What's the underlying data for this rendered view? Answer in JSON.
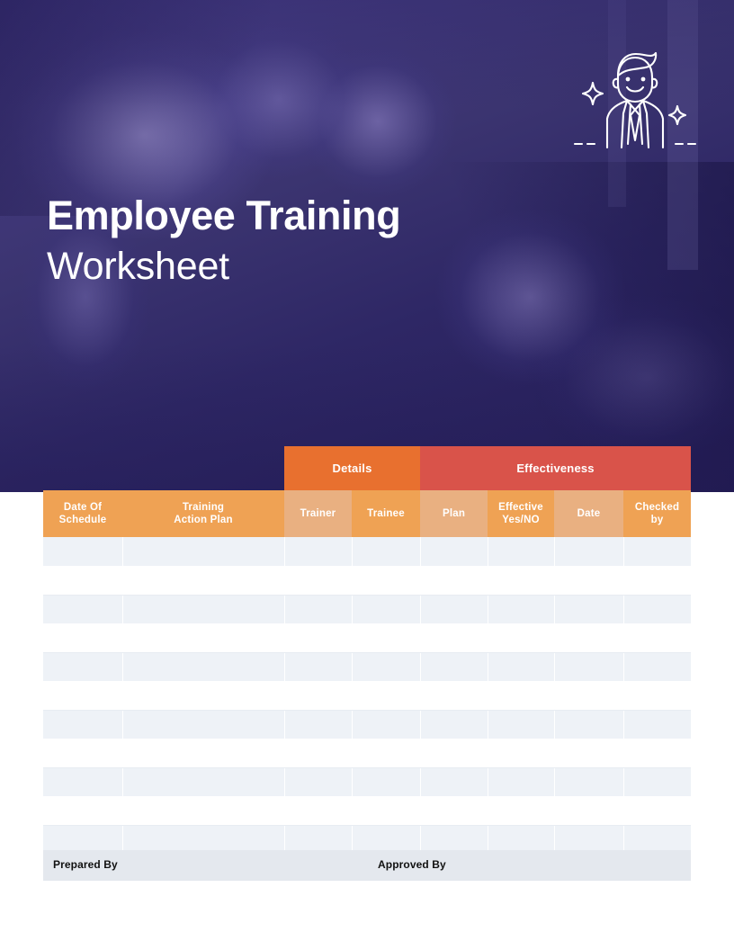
{
  "document": {
    "title_line1": "Employee Training",
    "title_line2": "Worksheet",
    "hero_icon": "businessman-line-art-icon",
    "colors": {
      "hero_purple": "#3B3470",
      "details_orange": "#E8702F",
      "effectiveness_red": "#D9534A",
      "header_cell_dark": "#EFA254",
      "header_cell_light": "#E9B081",
      "row_stripe": "#EEF2F7",
      "row_plain": "#FFFFFF",
      "footer_band": "#E4E8EE"
    }
  },
  "table": {
    "group_headers": [
      {
        "label": "",
        "span": 2,
        "style": "blank"
      },
      {
        "label": "Details",
        "span": 2,
        "style": "details"
      },
      {
        "label": "Effectiveness",
        "span": 4,
        "style": "effect"
      }
    ],
    "columns": [
      {
        "label": "Date Of\nSchedule",
        "line1": "Date Of",
        "line2": "Schedule",
        "shade": "dark"
      },
      {
        "label": "Training\nAction Plan",
        "line1": "Training",
        "line2": "Action Plan",
        "shade": "dark"
      },
      {
        "label": "Trainer",
        "line1": "Trainer",
        "line2": "",
        "shade": "light"
      },
      {
        "label": "Trainee",
        "line1": "Trainee",
        "line2": "",
        "shade": "dark"
      },
      {
        "label": "Plan",
        "line1": "Plan",
        "line2": "",
        "shade": "light"
      },
      {
        "label": "Effective\nYes/NO",
        "line1": "Effective",
        "line2": "Yes/NO",
        "shade": "dark"
      },
      {
        "label": "Date",
        "line1": "Date",
        "line2": "",
        "shade": "light"
      },
      {
        "label": "Checked\nby",
        "line1": "Checked",
        "line2": "by",
        "shade": "dark"
      }
    ],
    "row_count": 11,
    "rows": [
      [
        "",
        "",
        "",
        "",
        "",
        "",
        "",
        ""
      ],
      [
        "",
        "",
        "",
        "",
        "",
        "",
        "",
        ""
      ],
      [
        "",
        "",
        "",
        "",
        "",
        "",
        "",
        ""
      ],
      [
        "",
        "",
        "",
        "",
        "",
        "",
        "",
        ""
      ],
      [
        "",
        "",
        "",
        "",
        "",
        "",
        "",
        ""
      ],
      [
        "",
        "",
        "",
        "",
        "",
        "",
        "",
        ""
      ],
      [
        "",
        "",
        "",
        "",
        "",
        "",
        "",
        ""
      ],
      [
        "",
        "",
        "",
        "",
        "",
        "",
        "",
        ""
      ],
      [
        "",
        "",
        "",
        "",
        "",
        "",
        "",
        ""
      ],
      [
        "",
        "",
        "",
        "",
        "",
        "",
        "",
        ""
      ],
      [
        "",
        "",
        "",
        "",
        "",
        "",
        "",
        ""
      ]
    ]
  },
  "footer": {
    "prepared_by": "Prepared By",
    "approved_by": "Approved By"
  }
}
